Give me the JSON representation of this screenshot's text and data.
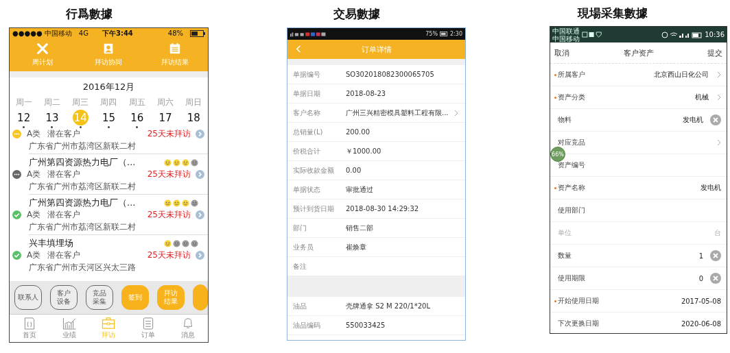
{
  "behavior": {
    "heading": "行爲數據",
    "status_bar": {
      "carrier": "●●●●● 中国移动",
      "network": "4G",
      "time": "下午3:44",
      "battery": "48%"
    },
    "shortcuts": [
      {
        "label": "周计划",
        "kind": "tools"
      },
      {
        "label": "拜访协同",
        "kind": "contact"
      },
      {
        "label": "拜访结果",
        "kind": "calendar"
      }
    ],
    "calendar": {
      "month": "2016年12月",
      "weekdays": [
        "周一",
        "周二",
        "周三",
        "周四",
        "周五",
        "周六",
        "周日"
      ],
      "days": [
        {
          "label": "12",
          "selected": false,
          "has_visits": true
        },
        {
          "label": "13",
          "selected": false,
          "has_visits": true
        },
        {
          "label": "14",
          "selected": true,
          "has_visits": true
        },
        {
          "label": "15",
          "selected": false,
          "has_visits": true
        },
        {
          "label": "16",
          "selected": false,
          "has_visits": true
        },
        {
          "label": "17",
          "selected": false,
          "has_visits": false
        },
        {
          "label": "18",
          "selected": false,
          "has_visits": false
        }
      ]
    },
    "customers": [
      {
        "kind": "in_progress",
        "category": "A类",
        "type": "潜在客户",
        "overdue": "25天未拜访",
        "address": "广东省广州市荔湾区新联二村"
      },
      {
        "kind": "pending",
        "name": "广州第四资源热力电厂（...",
        "stars": 3,
        "category": "A类",
        "type": "潜在客户",
        "overdue": "25天未拜访",
        "address": "广东省广州市荔湾区新联二村"
      },
      {
        "kind": "done",
        "name": "广州第四资源热力电厂（...",
        "stars": 3,
        "category": "A类",
        "type": "潜在客户",
        "overdue": "25天未拜访",
        "address": "广东省广州市荔湾区新联二村"
      },
      {
        "kind": "done",
        "name": "兴丰填埋场",
        "stars": 1,
        "category": "A类",
        "type": "潜在客户",
        "overdue": "25天未拜访",
        "address": "广东省广州市天河区兴太三路"
      }
    ],
    "actions": [
      {
        "lines": [
          "联系人"
        ],
        "kind": "outline"
      },
      {
        "lines": [
          "客户",
          "设备"
        ],
        "kind": "outline"
      },
      {
        "lines": [
          "竞品",
          "采集"
        ],
        "kind": "outline"
      },
      {
        "lines": [
          "签到"
        ],
        "kind": "filled"
      },
      {
        "lines": [
          "拜访",
          "结果"
        ],
        "kind": "filled"
      }
    ],
    "tabs": [
      {
        "label": "首页",
        "kind": "home",
        "selected": false
      },
      {
        "label": "业绩",
        "kind": "chart",
        "selected": false
      },
      {
        "label": "拜访",
        "kind": "briefcase",
        "selected": true
      },
      {
        "label": "订单",
        "kind": "list",
        "selected": false
      },
      {
        "label": "消息",
        "kind": "bell",
        "selected": false
      }
    ]
  },
  "transaction": {
    "heading": "交易數據",
    "status_bar": {
      "battery": "75%",
      "time": "2:30"
    },
    "title": "订单详情",
    "groups": [
      {
        "rows": [
          {
            "label": "单据编号",
            "value": "SO302018082300065705",
            "link": false
          },
          {
            "label": "单据日期",
            "value": "2018-08-23",
            "link": false
          },
          {
            "label": "客户名称",
            "value": "广州三兴精密模具塑料工程有限...",
            "link": true
          },
          {
            "label": "总销量(L)",
            "value": "200.00",
            "link": false
          },
          {
            "label": "价税合计",
            "value": "￥1000.00",
            "link": false
          },
          {
            "label": "实际收款金额",
            "value": "0.00",
            "link": false
          },
          {
            "label": "单据状态",
            "value": "审批通过",
            "link": false
          },
          {
            "label": "预计到货日期",
            "value": "2018-08-30 14:29:32",
            "link": false
          },
          {
            "label": "部门",
            "value": "销售二部",
            "link": false
          },
          {
            "label": "业务员",
            "value": "崔焕章",
            "link": false
          },
          {
            "label": "备注",
            "link": false
          }
        ]
      },
      {
        "rows": [
          {
            "label": "油品",
            "value": "壳牌通拿 S2 M 220/1*20L",
            "link": false
          },
          {
            "label": "油品编码",
            "value": "550033425",
            "link": false
          }
        ]
      }
    ]
  },
  "field_collection": {
    "heading": "現場采集數據",
    "status_bar": {
      "carriers": [
        "中国联通",
        "中国移动"
      ],
      "time": "10:36"
    },
    "cancel": "取消",
    "title": "客户资产",
    "submit": "提交",
    "floating_badge": "66%",
    "rows": [
      {
        "label": "所属客户",
        "required": true,
        "disabled": false,
        "value": "北京西山日化公司",
        "kind": "arrow"
      },
      {
        "label": "资产分类",
        "required": true,
        "disabled": false,
        "value": "机械",
        "kind": "arrow"
      },
      {
        "label": "物料",
        "required": false,
        "disabled": false,
        "value": "发电机",
        "kind": "clear"
      },
      {
        "label": "对应竞品",
        "required": false,
        "disabled": false,
        "kind": "arrow"
      },
      {
        "label": "资产编号",
        "required": false,
        "disabled": false,
        "kind": "plain"
      },
      {
        "label": "资产名称",
        "required": true,
        "disabled": false,
        "value": "发电机",
        "kind": "plain"
      },
      {
        "label": "使用部门",
        "required": false,
        "disabled": false,
        "kind": "plain"
      },
      {
        "label": "单位",
        "required": false,
        "disabled": true,
        "value": "台",
        "kind": "plain"
      },
      {
        "label": "数量",
        "required": false,
        "disabled": false,
        "value": "1",
        "kind": "clear"
      },
      {
        "label": "使用期限",
        "required": false,
        "disabled": false,
        "value": "0",
        "kind": "clear"
      },
      {
        "label": "开始使用日期",
        "required": true,
        "disabled": false,
        "value": "2017-05-08",
        "kind": "plain"
      },
      {
        "label": "下次更换日期",
        "required": false,
        "disabled": false,
        "value": "2020-06-08",
        "kind": "plain"
      }
    ]
  }
}
